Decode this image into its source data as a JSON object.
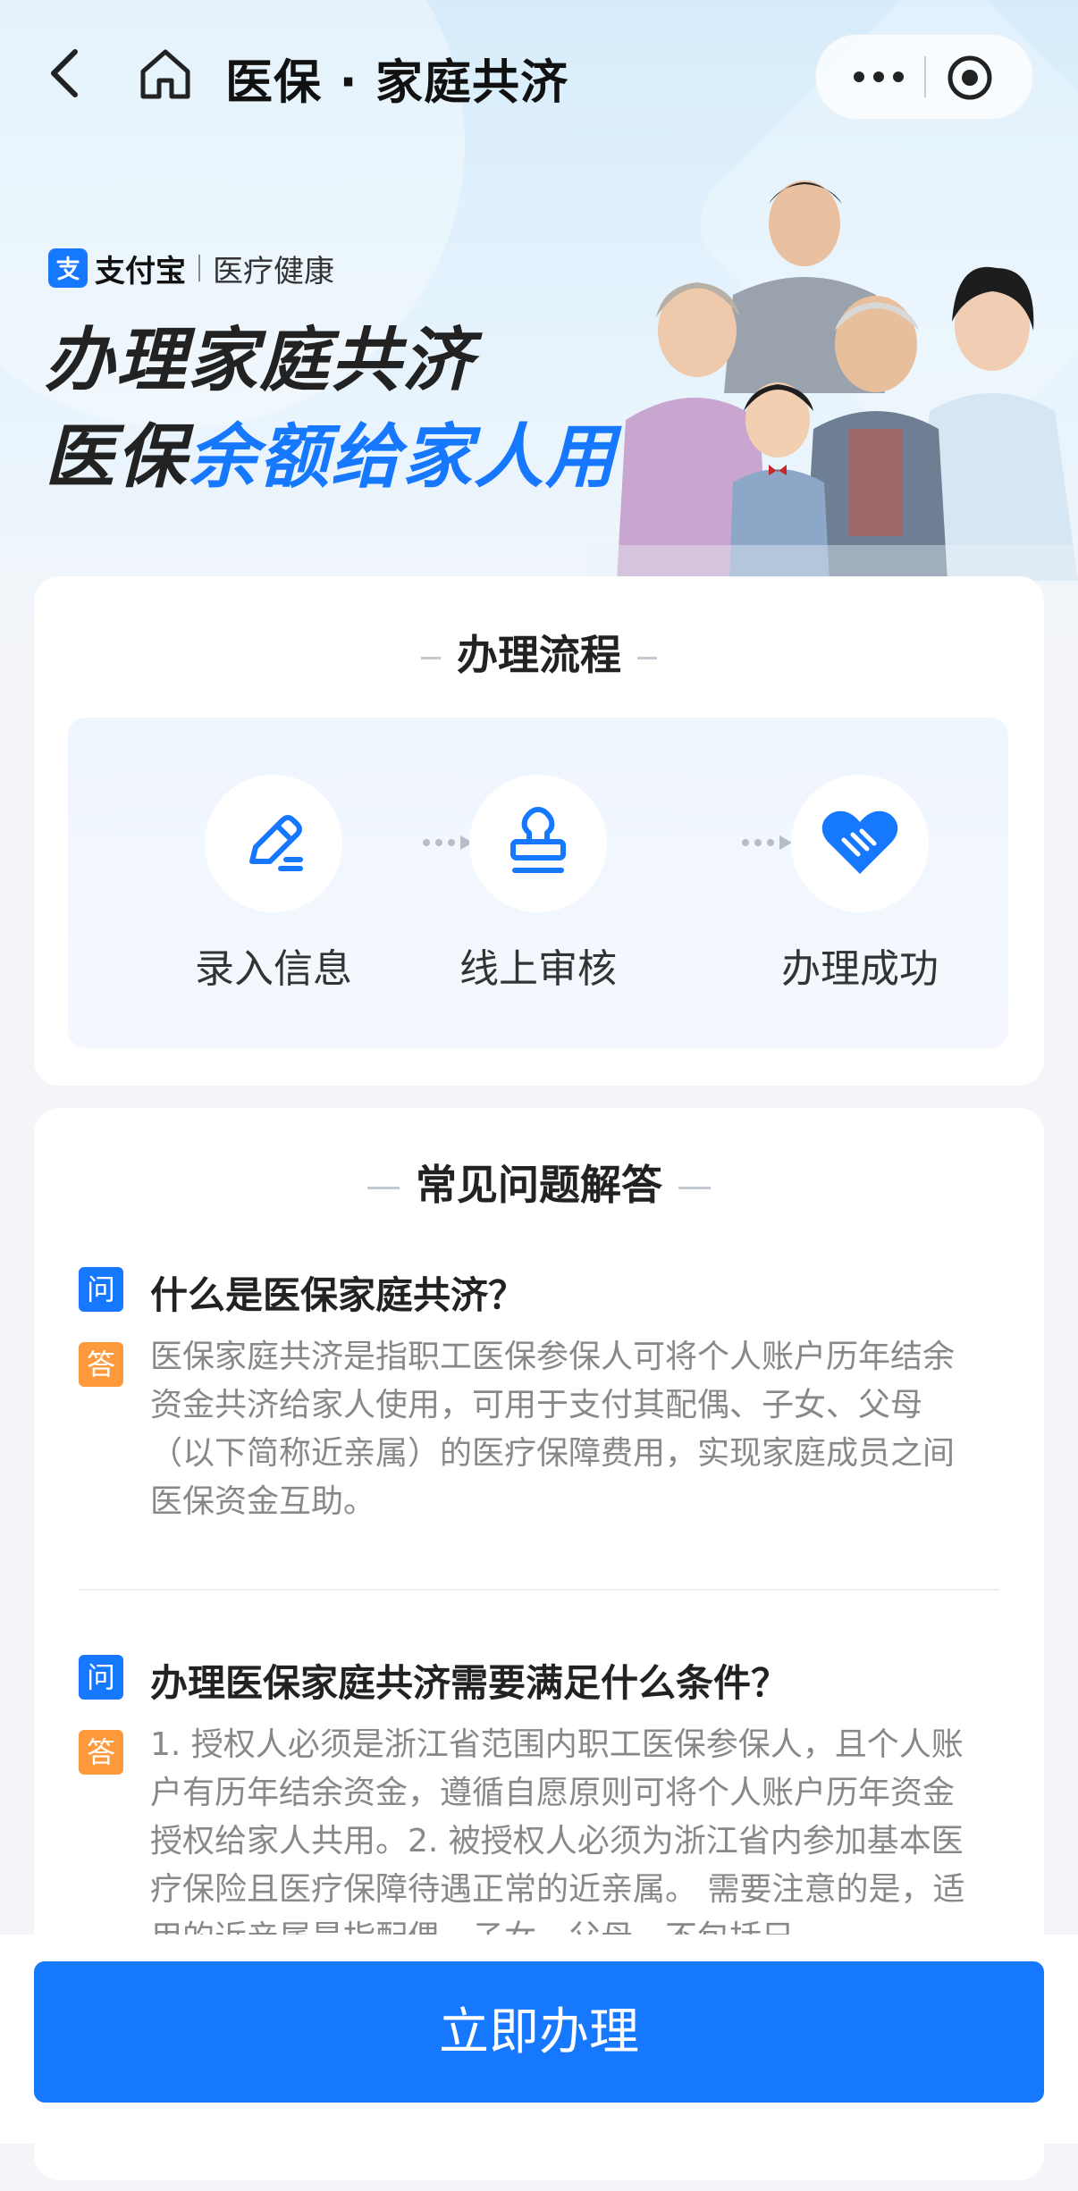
{
  "nav": {
    "title": "医保 · 家庭共济"
  },
  "brand": {
    "name": "支付宝",
    "category": "医疗健康"
  },
  "hero": {
    "line1": "办理家庭共济",
    "line2_prefix": "医保",
    "line2_highlight": "余额给家人用"
  },
  "process": {
    "title": "办理流程",
    "steps": [
      {
        "label": "录入信息",
        "icon": "pen-icon"
      },
      {
        "label": "线上审核",
        "icon": "stamp-icon"
      },
      {
        "label": "办理成功",
        "icon": "heart-handshake-icon"
      }
    ]
  },
  "faq": {
    "title": "常见问题解答",
    "q_badge": "问",
    "a_badge": "答",
    "items": [
      {
        "q": "什么是医保家庭共济？",
        "a": "医保家庭共济是指职工医保参保人可将个人账户历年结余资金共济给家人使用，可用于支付其配偶、子女、父母（以下简称近亲属）的医疗保障费用，实现家庭成员之间医保资金互助。"
      },
      {
        "q": "办理医保家庭共济需要满足什么条件？",
        "a": "1. 授权人必须是浙江省范围内职工医保参保人，且个人账户有历年结余资金，遵循自愿原则可将个人账户历年资金授权给家人共用。2. 被授权人必须为浙江省内参加基本医疗保险且医疗保障待遇正常的近亲属。 需要注意的是，适用的近亲属是指配偶、子女、父母，不包括兄"
      }
    ]
  },
  "cta": {
    "label": "立即办理"
  },
  "colors": {
    "accent": "#1677ff",
    "answer_badge": "#ff9a3c"
  }
}
